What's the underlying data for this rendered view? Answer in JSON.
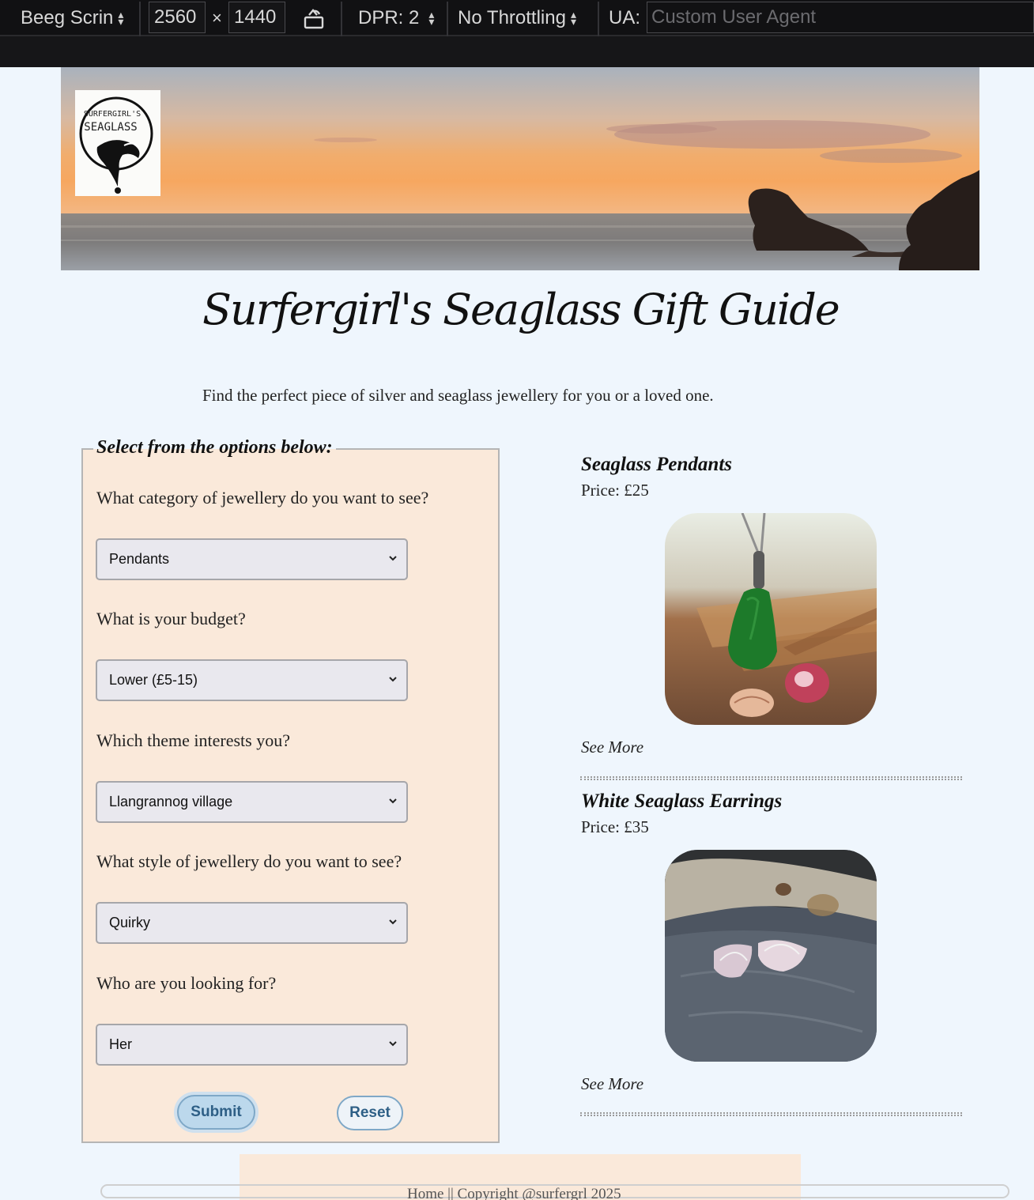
{
  "devtools": {
    "device": "Beeg Scrin",
    "width": "2560",
    "times": "×",
    "height": "1440",
    "dpr": "DPR: 2",
    "throttling": "No Throttling",
    "ua_label": "UA:",
    "ua_placeholder": "Custom User Agent"
  },
  "logo": {
    "line1": "SURFERGIRL'S",
    "line2": "SEAGLASS"
  },
  "page": {
    "title": "Surfergirl's Seaglass Gift Guide",
    "subtitle": "Find the perfect piece of silver and seaglass jewellery for you or a loved one."
  },
  "form": {
    "legend": "Select from the options below:",
    "questions": [
      {
        "label": "What category of jewellery do you want to see?",
        "value": "Pendants"
      },
      {
        "label": "What is your budget?",
        "value": "Lower (£5-15)"
      },
      {
        "label": "Which theme interests you?",
        "value": "Llangrannog village"
      },
      {
        "label": "What style of jewellery do you want to see?",
        "value": "Quirky"
      },
      {
        "label": "Who are you looking for?",
        "value": "Her"
      }
    ],
    "submit": "Submit",
    "reset": "Reset"
  },
  "products": [
    {
      "name": "Seaglass Pendants",
      "price": "Price: £25",
      "link": "See More"
    },
    {
      "name": "White Seaglass Earrings",
      "price": "Price: £35",
      "link": "See More"
    }
  ],
  "footer": {
    "text": "Home || Copyright @surfergrl 2025"
  },
  "colors": {
    "page_bg": "#eff6fd",
    "form_bg": "#fae9da",
    "button_accent": "#2e5f86"
  }
}
